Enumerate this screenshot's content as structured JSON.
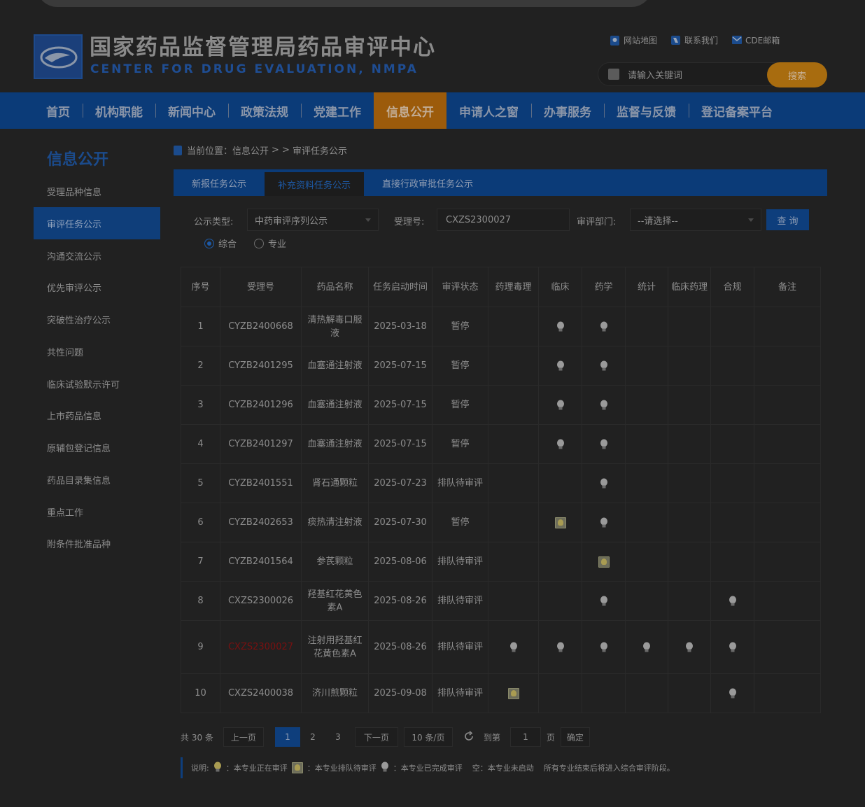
{
  "header": {
    "title_cn": "国家药品监督管理局药品审评中心",
    "title_en": "CENTER FOR DRUG EVALUATION, NMPA",
    "links": [
      "网站地图",
      "联系我们",
      "CDE邮箱"
    ],
    "search_placeholder": "请输入关键词",
    "search_button": "搜索"
  },
  "nav": [
    "首页",
    "机构职能",
    "新闻中心",
    "政策法规",
    "党建工作",
    "信息公开",
    "申请人之窗",
    "办事服务",
    "监督与反馈",
    "登记备案平台"
  ],
  "nav_active": "信息公开",
  "sidebar": {
    "title": "信息公开",
    "items": [
      "受理品种信息",
      "审评任务公示",
      "沟通交流公示",
      "优先审评公示",
      "突破性治疗公示",
      "共性问题",
      "临床试验默示许可",
      "上市药品信息",
      "原辅包登记信息",
      "药品目录集信息",
      "重点工作",
      "附条件批准品种"
    ],
    "active": "审评任务公示"
  },
  "breadcrumb": {
    "prefix": "当前位置：信息公开",
    "sep": "> >",
    "current": "审评任务公示"
  },
  "tabs": [
    "新报任务公示",
    "补充资料任务公示",
    "直接行政审批任务公示"
  ],
  "tab_active": "补充资料任务公示",
  "filters": {
    "type_label": "公示类型:",
    "type_value": "中药审评序列公示",
    "accept_label": "受理号:",
    "accept_value": "CXZS2300027",
    "dept_label": "审评部门:",
    "dept_value": "--请选择--",
    "query_button": "查 询",
    "radio_comprehensive": "综合",
    "radio_specialty": "专业"
  },
  "table": {
    "headers": [
      "序号",
      "受理号",
      "药品名称",
      "任务启动时间",
      "审评状态",
      "药理毒理",
      "临床",
      "药学",
      "统计",
      "临床药理",
      "合规",
      "备注"
    ],
    "rows": [
      {
        "no": "1",
        "id": "CYZB2400668",
        "name": "清热解毒口服液",
        "date": "2025-03-18",
        "status": "暂停",
        "marks": [
          "",
          "ing",
          "ing",
          "",
          "",
          "",
          ""
        ]
      },
      {
        "no": "2",
        "id": "CYZB2401295",
        "name": "血塞通注射液",
        "date": "2025-07-15",
        "status": "暂停",
        "marks": [
          "",
          "ing",
          "ing",
          "",
          "",
          "",
          ""
        ]
      },
      {
        "no": "3",
        "id": "CYZB2401296",
        "name": "血塞通注射液",
        "date": "2025-07-15",
        "status": "暂停",
        "marks": [
          "",
          "ing",
          "ing",
          "",
          "",
          "",
          ""
        ]
      },
      {
        "no": "4",
        "id": "CYZB2401297",
        "name": "血塞通注射液",
        "date": "2025-07-15",
        "status": "暂停",
        "marks": [
          "",
          "ing",
          "ing",
          "",
          "",
          "",
          ""
        ]
      },
      {
        "no": "5",
        "id": "CYZB2401551",
        "name": "肾石通颗粒",
        "date": "2025-07-23",
        "status": "排队待审评",
        "marks": [
          "",
          "",
          "ing",
          "",
          "",
          "",
          ""
        ]
      },
      {
        "no": "6",
        "id": "CYZB2402653",
        "name": "痰热清注射液",
        "date": "2025-07-30",
        "status": "暂停",
        "marks": [
          "",
          "queued",
          "ing",
          "",
          "",
          "",
          ""
        ]
      },
      {
        "no": "7",
        "id": "CYZB2401564",
        "name": "参芪颗粒",
        "date": "2025-08-06",
        "status": "排队待审评",
        "marks": [
          "",
          "",
          "queued",
          "",
          "",
          "",
          ""
        ]
      },
      {
        "no": "8",
        "id": "CXZS2300026",
        "name": "羟基红花黄色素A",
        "date": "2025-08-26",
        "status": "排队待审评",
        "marks": [
          "",
          "",
          "ing",
          "",
          "",
          "ing",
          ""
        ]
      },
      {
        "no": "9",
        "id": "CXZS2300027",
        "name": "注射用羟基红花黄色素A",
        "date": "2025-08-26",
        "status": "排队待审评",
        "marks": [
          "ing",
          "ing",
          "ing",
          "ing",
          "ing",
          "ing",
          ""
        ],
        "highlight": true
      },
      {
        "no": "10",
        "id": "CXZS2400038",
        "name": "济川煎颗粒",
        "date": "2025-09-08",
        "status": "排队待审评",
        "marks": [
          "queued",
          "",
          "",
          "",
          "",
          "ing",
          ""
        ]
      }
    ]
  },
  "pager": {
    "total": "共 30 条",
    "prev": "上一页",
    "pages": [
      "1",
      "2",
      "3"
    ],
    "current": "1",
    "next": "下一页",
    "page_size": "10 条/页",
    "goto_label": "到第",
    "goto_value": "1",
    "page_unit": "页",
    "confirm": "确定"
  },
  "legend": {
    "label": "说明:",
    "ing": "：本专业正在审评",
    "queued": "：本专业排队待审评",
    "done": "：本专业已完成审评",
    "empty": "空：本专业未启动",
    "note": "所有专业结束后将进入综合审评阶段。"
  },
  "colors": {
    "nav_bg": "#0b3b78",
    "nav_active": "#9c5b0b",
    "search_btn": "#a86c0f",
    "highlight": "#7a1010"
  }
}
